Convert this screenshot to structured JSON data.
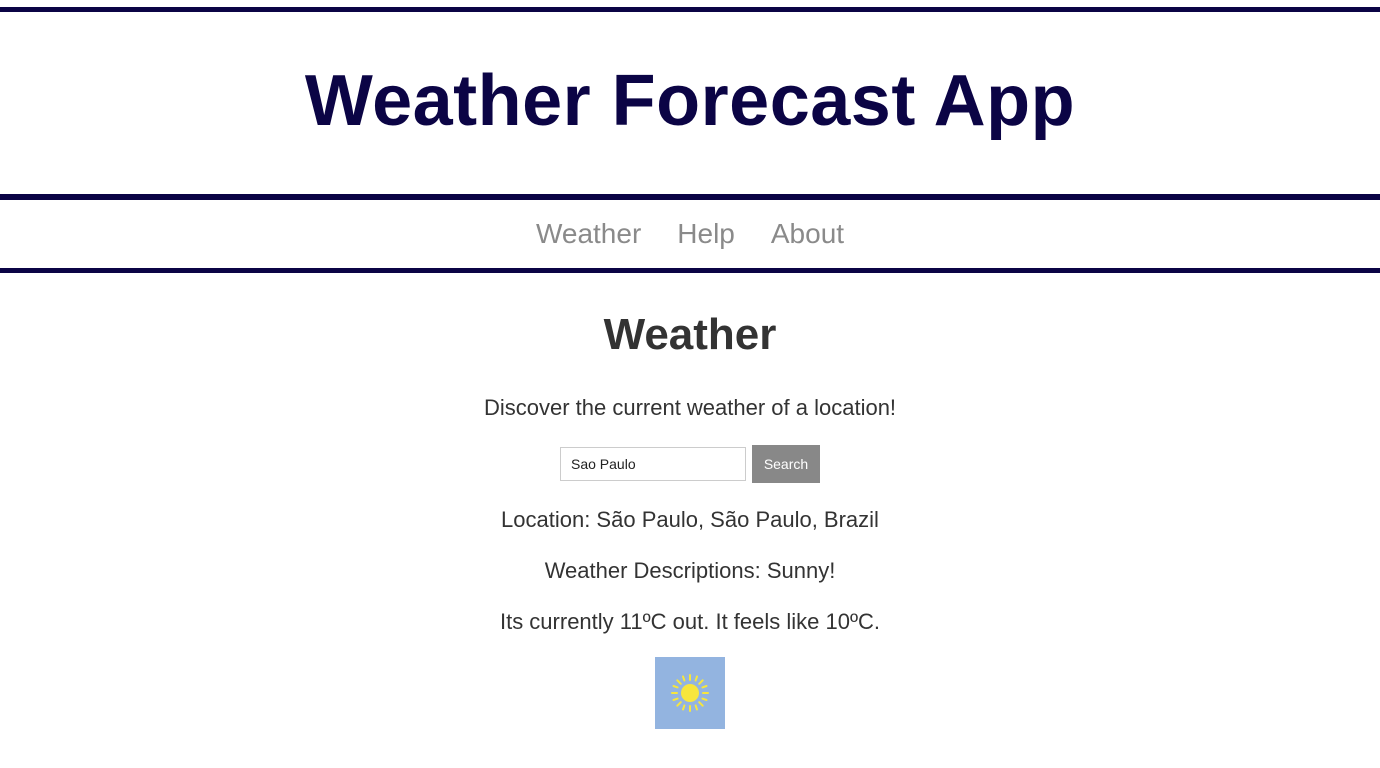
{
  "header": {
    "title": "Weather Forecast App"
  },
  "nav": {
    "items": [
      {
        "label": "Weather"
      },
      {
        "label": "Help"
      },
      {
        "label": "About"
      }
    ]
  },
  "main": {
    "heading": "Weather",
    "tagline": "Discover the current weather of a location!",
    "search": {
      "value": "Sao Paulo",
      "button_label": "Search"
    },
    "location_text": "Location: São Paulo, São Paulo, Brazil",
    "description_text": "Weather Descriptions: Sunny!",
    "temperature_text": "Its currently 11ºC out. It feels like 10ºC.",
    "weather_icon": {
      "name": "sun-icon",
      "background_color": "#93b4e0",
      "sun_color": "#f7e63c"
    }
  },
  "colors": {
    "brand": "#0b0445",
    "nav_text": "#8a8a8a",
    "body_text": "#333333",
    "button": "#888888"
  }
}
